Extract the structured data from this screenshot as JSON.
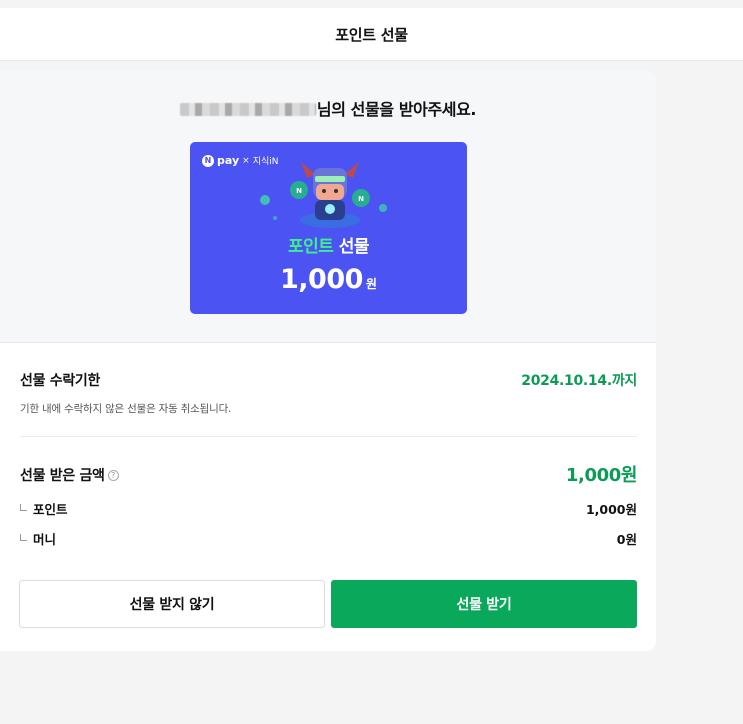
{
  "header": {
    "title": "포인트 선물"
  },
  "sender": {
    "suffix": "님의 선물을 받아주세요."
  },
  "gift_card": {
    "brand_logo": "N",
    "brand_name": "pay",
    "brand_times": "×",
    "brand_partner": "지식iN",
    "title_accent": "포인트",
    "title_rest": " 선물",
    "amount": "1,000",
    "currency": "원"
  },
  "deadline": {
    "label": "선물 수락기한",
    "date": "2024.10.14.까지",
    "note": "기한 내에 수락하지 않은 선물은 자동 취소됩니다."
  },
  "amount": {
    "label": "선물 받은 금액",
    "help_icon": "?",
    "total": "1,000원",
    "rows": [
      {
        "label": "포인트",
        "value": "1,000원"
      },
      {
        "label": "머니",
        "value": "0원"
      }
    ]
  },
  "buttons": {
    "decline": "선물 받지 않기",
    "accept": "선물 받기"
  },
  "colors": {
    "accent_green": "#0aa85a",
    "card_blue": "#4b54f2"
  }
}
